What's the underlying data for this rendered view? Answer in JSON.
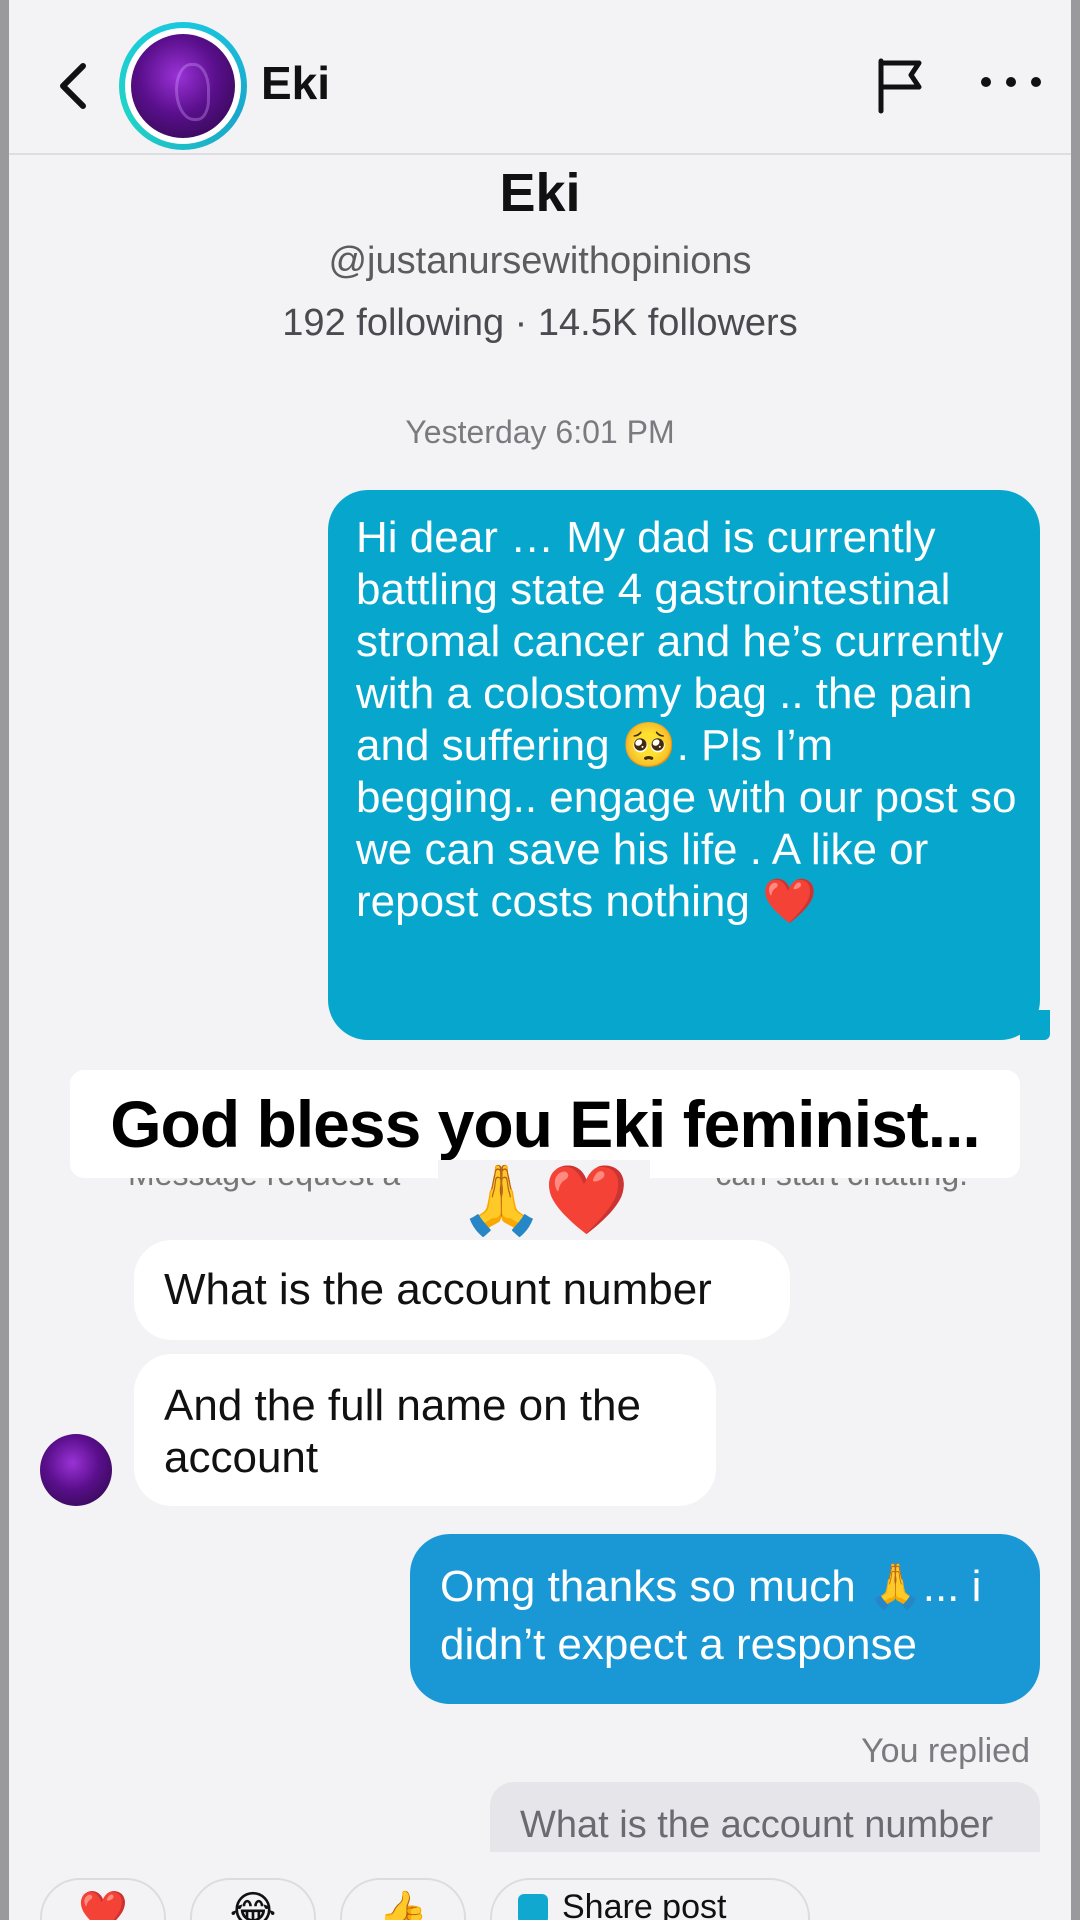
{
  "header": {
    "name": "Eki"
  },
  "profile": {
    "name": "Eki",
    "handle": "@justanursewithopinions",
    "stats": "192 following · 14.5K followers"
  },
  "chat": {
    "timestamp": "Yesterday 6:01 PM",
    "outgoing_message_1": "Hi dear … My dad is currently battling state 4 gastrointestinal stromal cancer and he’s currently with a colostomy bag .. the pain and suffering 🥺. Pls I’m begging.. engage with our post so we can save his life . A like or repost  costs nothing ❤️",
    "overlay_caption": "God bless you Eki feminist...",
    "request_note_left": "Message request a",
    "request_note_right": "can start chatting.",
    "reaction": "🙏❤️",
    "incoming_message_1": "What is the account number",
    "incoming_message_2": "And the full name on the account",
    "outgoing_message_2": "Omg thanks so much 🙏... i didn’t expect a response",
    "you_replied": "You replied",
    "reply_preview": "What is the account number"
  },
  "quick_actions": {
    "heart": "❤️",
    "laugh": "😂",
    "thumb": "👍",
    "share_label": "Share post"
  },
  "colors": {
    "outgoing_bubble": "#07a7cd",
    "outgoing_bubble_2": "#1a98d6",
    "incoming_bubble": "#ffffff",
    "background": "#f3f3f5"
  }
}
